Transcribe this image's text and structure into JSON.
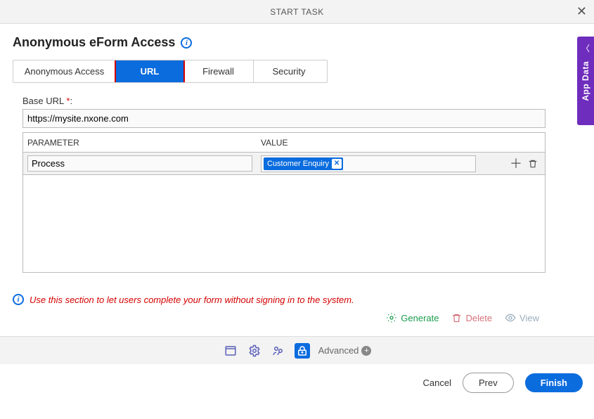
{
  "header": {
    "title": "START TASK"
  },
  "page": {
    "title": "Anonymous eForm Access"
  },
  "tabs": {
    "items": [
      "Anonymous Access",
      "URL",
      "Firewall",
      "Security"
    ],
    "activeIndex": 1
  },
  "form": {
    "baseUrlLabel": "Base URL",
    "baseUrlValue": "https://mysite.nxone.com",
    "headers": {
      "param": "PARAMETER",
      "value": "VALUE"
    },
    "rows": [
      {
        "param": "Process",
        "value": "Customer Enquiry"
      }
    ]
  },
  "hint": "Use this section to let users complete your form without signing in to the system.",
  "actions": {
    "generate": "Generate",
    "delete": "Delete",
    "view": "View"
  },
  "bottombar": {
    "advanced": "Advanced"
  },
  "footer": {
    "cancel": "Cancel",
    "prev": "Prev",
    "finish": "Finish"
  },
  "sidebar": {
    "label": "App Data"
  }
}
